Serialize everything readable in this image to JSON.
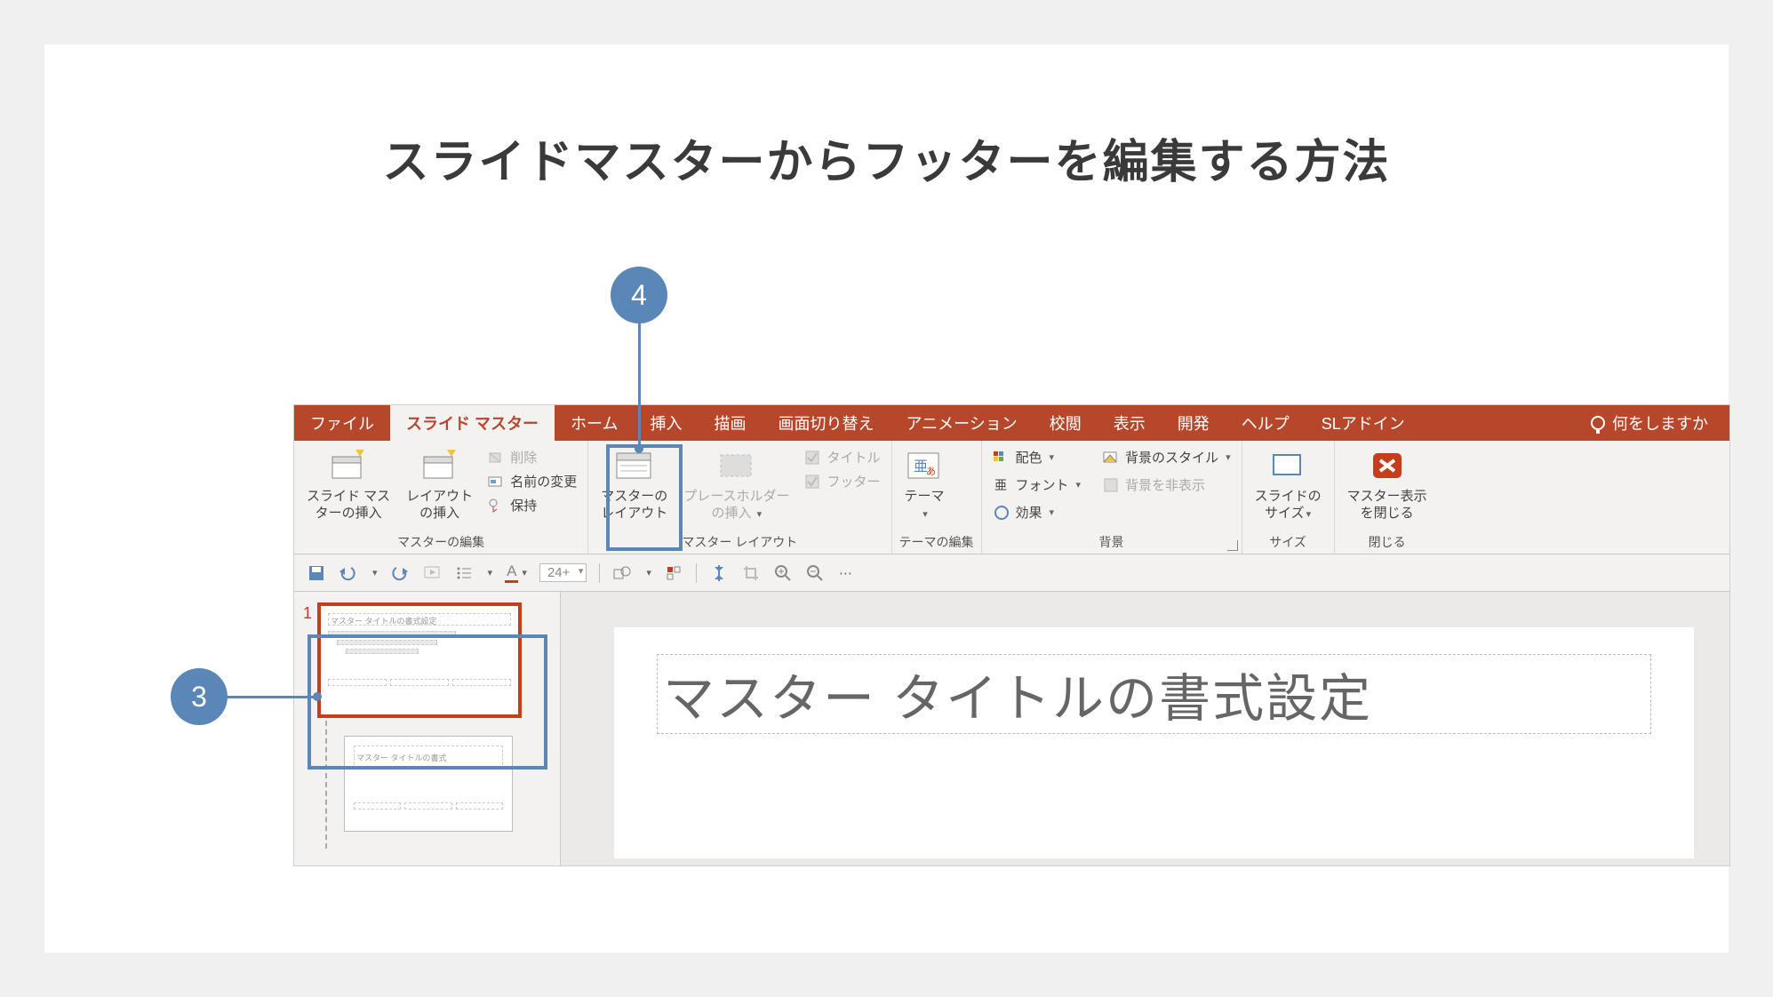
{
  "heading": "スライドマスターからフッターを編集する方法",
  "tabs": {
    "file": "ファイル",
    "slide_master": "スライド マスター",
    "home": "ホーム",
    "insert": "挿入",
    "draw": "描画",
    "transitions": "画面切り替え",
    "animations": "アニメーション",
    "review": "校閲",
    "view": "表示",
    "developer": "開発",
    "help": "ヘルプ",
    "sl_addin": "SLアドイン",
    "tell_me": "何をしますか"
  },
  "ribbon": {
    "edit_master": {
      "label": "マスターの編集",
      "insert_slide_master": "スライド マス\nターの挿入",
      "insert_layout": "レイアウト\nの挿入",
      "delete": "削除",
      "rename": "名前の変更",
      "preserve": "保持"
    },
    "master_layout": {
      "label": "マスター レイアウト",
      "master_layout": "マスターの\nレイアウト",
      "insert_placeholder": "プレースホルダー\nの挿入",
      "title": "タイトル",
      "footer": "フッター"
    },
    "edit_theme": {
      "label": "テーマの編集",
      "theme": "テーマ"
    },
    "background": {
      "label": "背景",
      "colors": "配色",
      "fonts": "フォント",
      "effects": "効果",
      "bg_styles": "背景のスタイル",
      "hide_bg": "背景を非表示"
    },
    "size": {
      "label": "サイズ",
      "slide_size": "スライドの\nサイズ"
    },
    "close": {
      "label": "閉じる",
      "close_master": "マスター表示\nを閉じる"
    }
  },
  "qat": {
    "font_size": "24+"
  },
  "thumbs": {
    "master_number": "1",
    "master_mini_title": "マスター タイトルの書式設定",
    "layout_mini_title": "マスター タイトルの書式"
  },
  "slide": {
    "title": "マスター タイトルの書式設定"
  },
  "callouts": {
    "c3": "3",
    "c4": "4"
  }
}
